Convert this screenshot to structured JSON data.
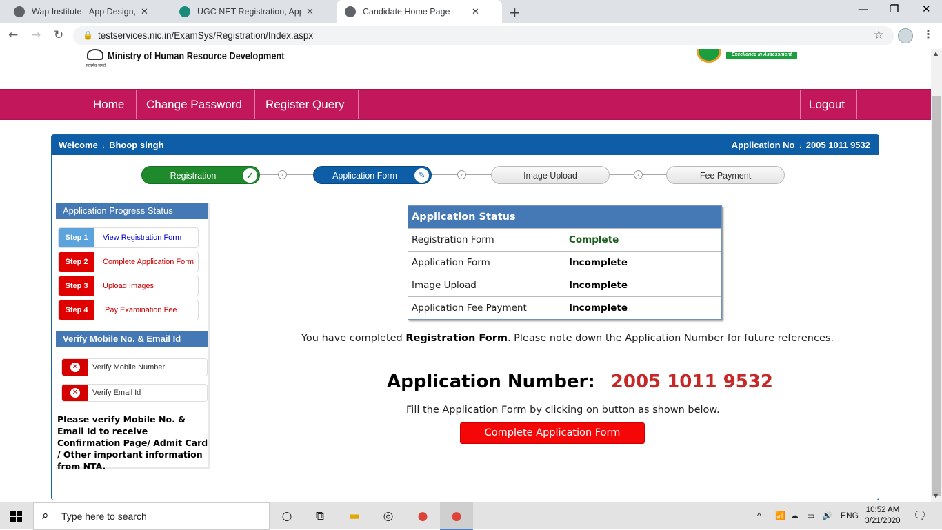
{
  "browser": {
    "tabs": [
      {
        "title": "Wap Institute - App Design, Software",
        "active": false
      },
      {
        "title": "UGC NET Registration, Application",
        "active": false
      },
      {
        "title": "Candidate Home Page",
        "active": true
      }
    ],
    "new_tab_label": "+",
    "url": "testservices.nic.in/ExamSys/Registration/Index.aspx"
  },
  "header": {
    "ministry": "Ministry of Human Resource Development",
    "nta_tagline": "Excellence in Assessment"
  },
  "nav": {
    "items": [
      "Home",
      "Change Password",
      "Register Query"
    ],
    "logout": "Logout"
  },
  "panel": {
    "welcome_label": "Welcome",
    "candidate_name": "Bhoop singh",
    "app_no_label": "Application No",
    "app_no": "2005 1011 9532"
  },
  "stepper": {
    "steps": [
      "Registration",
      "Application Form",
      "Image Upload",
      "Fee Payment"
    ]
  },
  "sidebar": {
    "progress_title": "Application Progress Status",
    "steps": [
      {
        "badge": "Step 1",
        "label": "View Registration Form",
        "badge_color": "#5aa3dd",
        "label_color": "#0000cc"
      },
      {
        "badge": "Step 2",
        "label": "Complete Application Form",
        "badge_color": "#e00000",
        "label_color": "#cc0000"
      },
      {
        "badge": "Step 3",
        "label": "Upload Images",
        "badge_color": "#e00000",
        "label_color": "#cc0000"
      },
      {
        "badge": "Step 4",
        "label": "Pay Examination Fee",
        "badge_color": "#e00000",
        "label_color": "#cc0000"
      }
    ],
    "verify_title": "Verify Mobile No. & Email Id",
    "verify_items": [
      "Verify Mobile Number",
      "Verify Email Id"
    ],
    "note": "Please verify Mobile No. & Email Id to receive Confirmation Page/ Admit Card / Other important information from NTA."
  },
  "status_table": {
    "title": "Application Status",
    "rows": [
      {
        "item": "Registration Form",
        "status": "Complete",
        "color": "#1b5e20"
      },
      {
        "item": "Application Form",
        "status": "Incomplete",
        "color": "#000000"
      },
      {
        "item": "Image Upload",
        "status": "Incomplete",
        "color": "#000000"
      },
      {
        "item": "Application Fee Payment",
        "status": "Incomplete",
        "color": "#000000"
      }
    ]
  },
  "message": {
    "pre": "You have completed ",
    "bold": "Registration Form",
    "post": ". Please note down the Application Number for future references."
  },
  "application_number": {
    "label": "Application Number:",
    "value": "2005 1011 9532"
  },
  "fill_note": "Fill the Application Form by clicking on button as shown below.",
  "cta_label": "Complete Application Form",
  "taskbar": {
    "search_placeholder": "Type here to search",
    "language": "ENG",
    "time": "10:52 AM",
    "date": "3/21/2020"
  },
  "colors": {
    "navbar": "#c2185b",
    "panel_header": "#0d5ea6",
    "cta": "#f50707",
    "app_number": "#c62828"
  }
}
